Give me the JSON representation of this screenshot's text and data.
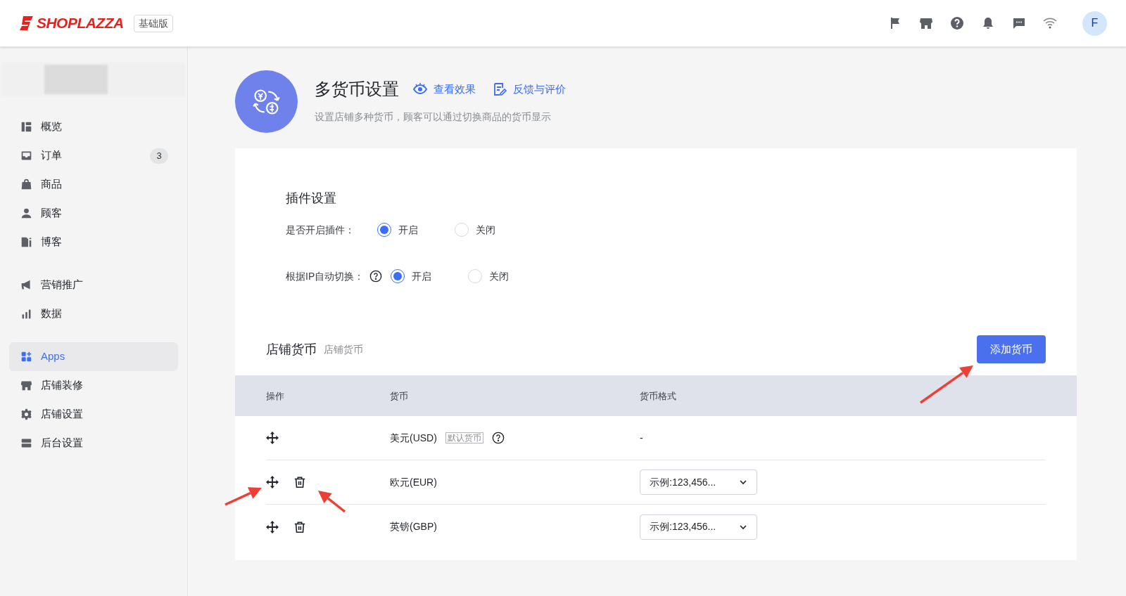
{
  "header": {
    "logo_text": "SHOPLAZZA",
    "plan_badge": "基础版",
    "avatar": "F"
  },
  "sidebar": {
    "groups": [
      [
        {
          "label": "概览",
          "selected": false
        },
        {
          "label": "订单",
          "selected": false,
          "badge": "3"
        },
        {
          "label": "商品",
          "selected": false
        },
        {
          "label": "顾客",
          "selected": false
        },
        {
          "label": "博客",
          "selected": false
        }
      ],
      [
        {
          "label": "营销推广",
          "selected": false
        },
        {
          "label": "数据",
          "selected": false
        }
      ],
      [
        {
          "label": "Apps",
          "selected": true
        },
        {
          "label": "店铺装修",
          "selected": false
        },
        {
          "label": "店铺设置",
          "selected": false
        },
        {
          "label": "后台设置",
          "selected": false
        }
      ]
    ]
  },
  "page": {
    "title": "多货币设置",
    "links": [
      "查看效果",
      "反馈与评价"
    ],
    "description": "设置店铺多种货币，顾客可以通过切换商品的货币显示"
  },
  "plugin_settings": {
    "title": "插件设置",
    "rows": [
      {
        "label": "是否开启插件：",
        "help": false,
        "options": [
          {
            "label": "开启",
            "selected": true
          },
          {
            "label": "关闭",
            "selected": false
          }
        ]
      },
      {
        "label": "根据IP自动切换：",
        "help": true,
        "options": [
          {
            "label": "开启",
            "selected": true
          },
          {
            "label": "关闭",
            "selected": false
          }
        ]
      }
    ]
  },
  "currencies": {
    "title": "店铺货币",
    "subtitle": "店铺货币",
    "add_button": "添加货币",
    "columns": [
      "操作",
      "货币",
      "货币格式"
    ],
    "rows": [
      {
        "name": "美元(USD)",
        "default_badge": "默认货币",
        "help": true,
        "deletable": false,
        "kind": "text",
        "format": "-"
      },
      {
        "name": "欧元(EUR)",
        "help": false,
        "deletable": true,
        "kind": "select",
        "format": "示例:123,456..."
      },
      {
        "name": "英镑(GBP)",
        "help": false,
        "deletable": true,
        "kind": "select",
        "format": "示例:123,456..."
      }
    ]
  }
}
